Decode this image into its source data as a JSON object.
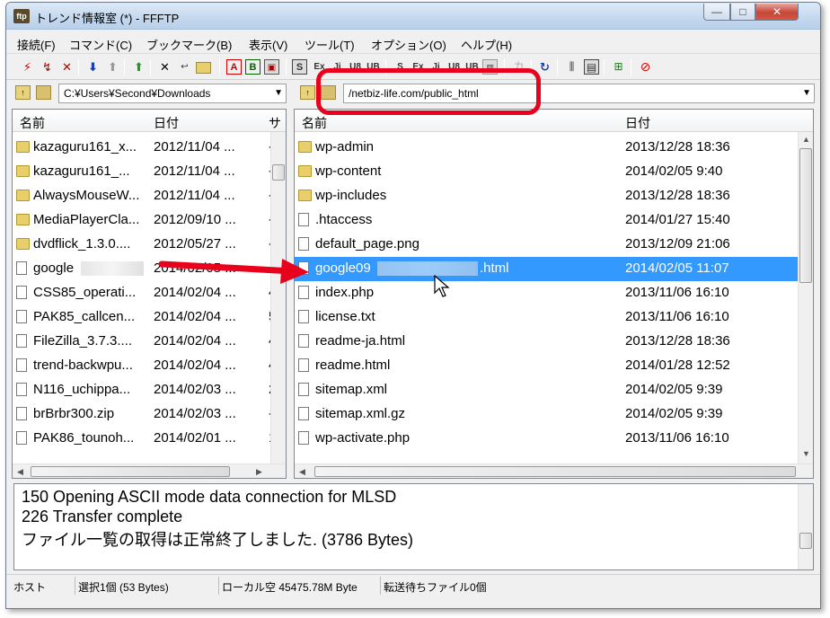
{
  "window": {
    "title": "トレンド情報室 (*) - FFFTP",
    "app_icon": "ffftp-icon",
    "minimize": "—",
    "maximize": "□",
    "close": "✕"
  },
  "menu": [
    "接続(F)",
    "コマンド(C)",
    "ブックマーク(B)",
    "表示(V)",
    "ツール(T)",
    "オプション(O)",
    "ヘルプ(H)"
  ],
  "toolbar": {
    "labels": {
      "ascii": "A",
      "binary": "B",
      "kanji_s": "S",
      "ka": "カ"
    },
    "icons": [
      "connect-icon",
      "quick-connect-icon",
      "disconnect-icon",
      "download-icon",
      "upload-icon",
      "mirror-upload-icon",
      "delete-icon",
      "rename-icon",
      "mkdir-icon",
      "ascii-mode-icon",
      "binary-mode-icon",
      "auto-mode-icon",
      "sjis-icon",
      "euc-icon",
      "jis-icon",
      "utf8-icon",
      "utf8bom-icon",
      "no-convert-icon",
      "kana-icon",
      "refresh-icon",
      "list-view-icon",
      "detail-view-icon",
      "sync-icon",
      "stop-icon"
    ]
  },
  "local": {
    "path": "C:¥Users¥Second¥Downloads",
    "headers": {
      "name": "名前",
      "date": "日付",
      "extra": "サ"
    },
    "files": [
      {
        "name": "kazaguru161_x...",
        "date": "2012/11/04 ...",
        "type": "folder",
        "extra": "-"
      },
      {
        "name": "kazaguru161_...",
        "date": "2012/11/04 ...",
        "type": "folder",
        "extra": "-"
      },
      {
        "name": "AlwaysMouseW...",
        "date": "2012/11/04 ...",
        "type": "folder",
        "extra": "-"
      },
      {
        "name": "MediaPlayerCla...",
        "date": "2012/09/10 ...",
        "type": "folder",
        "extra": "-"
      },
      {
        "name": "dvdflick_1.3.0....",
        "date": "2012/05/27 ...",
        "type": "folder",
        "extra": "-"
      },
      {
        "name": "google",
        "date": "2014/02/05 ...",
        "type": "file",
        "extra": "",
        "blurred": true
      },
      {
        "name": "CSS85_operati...",
        "date": "2014/02/04 ...",
        "type": "file",
        "extra": "4"
      },
      {
        "name": "PAK85_callcen...",
        "date": "2014/02/04 ...",
        "type": "file",
        "extra": "5"
      },
      {
        "name": "FileZilla_3.7.3....",
        "date": "2014/02/04 ...",
        "type": "file",
        "extra": "4"
      },
      {
        "name": "trend-backwpu...",
        "date": "2014/02/04 ...",
        "type": "file",
        "extra": "4"
      },
      {
        "name": "N116_uchippa...",
        "date": "2014/02/03 ...",
        "type": "file",
        "extra": "2"
      },
      {
        "name": "brBrbr300.zip",
        "date": "2014/02/03 ...",
        "type": "file",
        "extra": "-"
      },
      {
        "name": "PAK86_tounoh...",
        "date": "2014/02/01 ...",
        "type": "file",
        "extra": "1"
      }
    ]
  },
  "remote": {
    "path": "/netbiz-life.com/public_html",
    "headers": {
      "name": "名前",
      "date": "日付"
    },
    "files": [
      {
        "name": "wp-admin",
        "date": "2013/12/28 18:36",
        "type": "folder"
      },
      {
        "name": "wp-content",
        "date": "2014/02/05  9:40",
        "type": "folder"
      },
      {
        "name": "wp-includes",
        "date": "2013/12/28 18:36",
        "type": "folder"
      },
      {
        "name": ".htaccess",
        "date": "2014/01/27 15:40",
        "type": "file"
      },
      {
        "name": "default_page.png",
        "date": "2013/12/09 21:06",
        "type": "file"
      },
      {
        "name": "google09",
        "name_suffix": ".html",
        "date": "2014/02/05 11:07",
        "type": "file",
        "selected": true
      },
      {
        "name": "index.php",
        "date": "2013/11/06 16:10",
        "type": "file"
      },
      {
        "name": "license.txt",
        "date": "2013/11/06 16:10",
        "type": "file"
      },
      {
        "name": "readme-ja.html",
        "date": "2013/12/28 18:36",
        "type": "file"
      },
      {
        "name": "readme.html",
        "date": "2014/01/28 12:52",
        "type": "file"
      },
      {
        "name": "sitemap.xml",
        "date": "2014/02/05  9:39",
        "type": "file"
      },
      {
        "name": "sitemap.xml.gz",
        "date": "2014/02/05  9:39",
        "type": "file"
      },
      {
        "name": "wp-activate.php",
        "date": "2013/11/06 16:10",
        "type": "file"
      }
    ]
  },
  "log": [
    "150 Opening ASCII mode data connection for MLSD",
    "226 Transfer complete",
    "ファイル一覧の取得は正常終了しました. (3786 Bytes)"
  ],
  "status": {
    "host": "ホスト",
    "selection": "選択1個 (53 Bytes)",
    "local_free": "ローカル空 45475.78M Byte",
    "queue": "転送待ちファイル0個"
  },
  "colors": {
    "selection": "#3399ff",
    "annotation": "#e8001c"
  }
}
